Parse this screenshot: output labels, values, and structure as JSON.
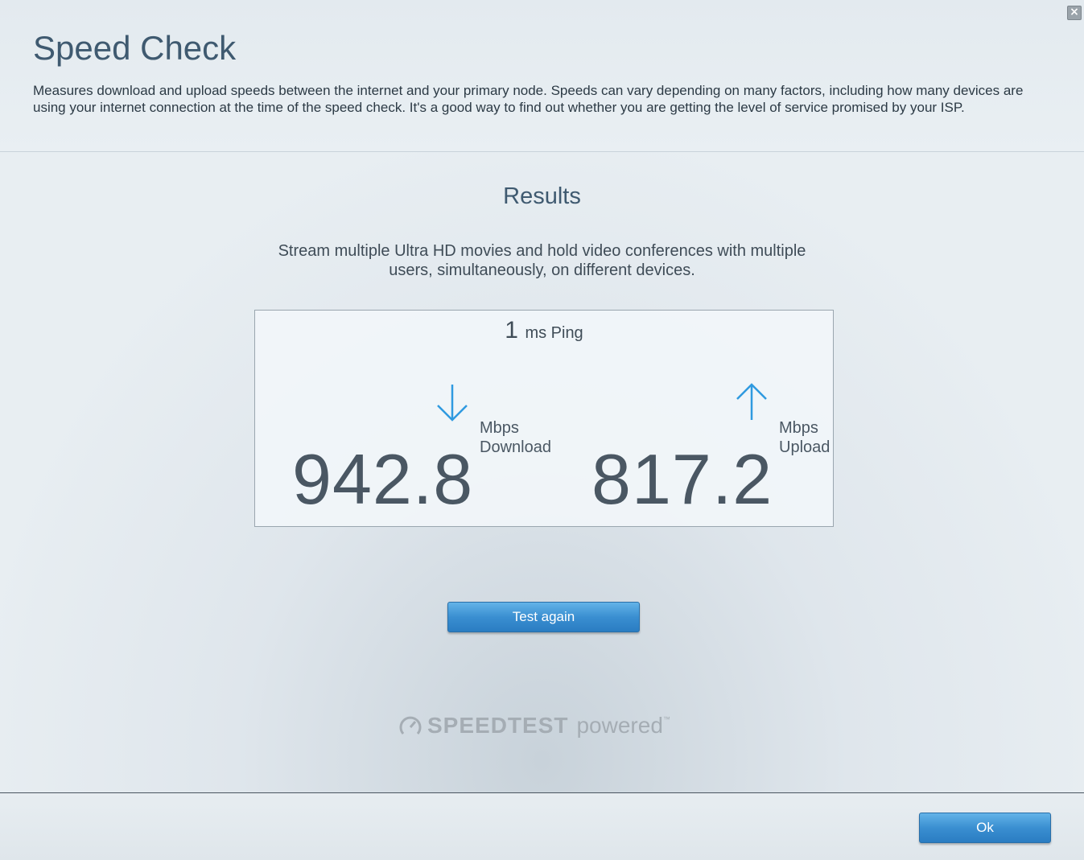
{
  "dialog": {
    "title": "Speed Check",
    "description": "Measures download and upload speeds between the internet and your primary node. Speeds can vary depending on many factors, including how many devices are using your internet connection at the time of the speed check. It's a good way to find out whether you are getting the level of service promised by your ISP.",
    "close_icon": "close-icon"
  },
  "results": {
    "title": "Results",
    "description": "Stream multiple Ultra HD movies and hold video conferences with multiple users, simultaneously, on different devices.",
    "ping": {
      "value": "1",
      "label": "ms Ping"
    },
    "download": {
      "value": "942.8",
      "unit": "Mbps",
      "label": "Download",
      "icon": "arrow-down-icon"
    },
    "upload": {
      "value": "817.2",
      "unit": "Mbps",
      "label": "Upload",
      "icon": "arrow-up-icon"
    }
  },
  "buttons": {
    "test_again": "Test again",
    "ok": "Ok"
  },
  "branding": {
    "brand": "SPEEDTEST",
    "suffix": "powered",
    "trademark": "™",
    "icon": "speedometer-icon"
  },
  "colors": {
    "accent": "#3a8fd1",
    "arrow": "#2f9ae0",
    "title": "#3f5a70"
  }
}
